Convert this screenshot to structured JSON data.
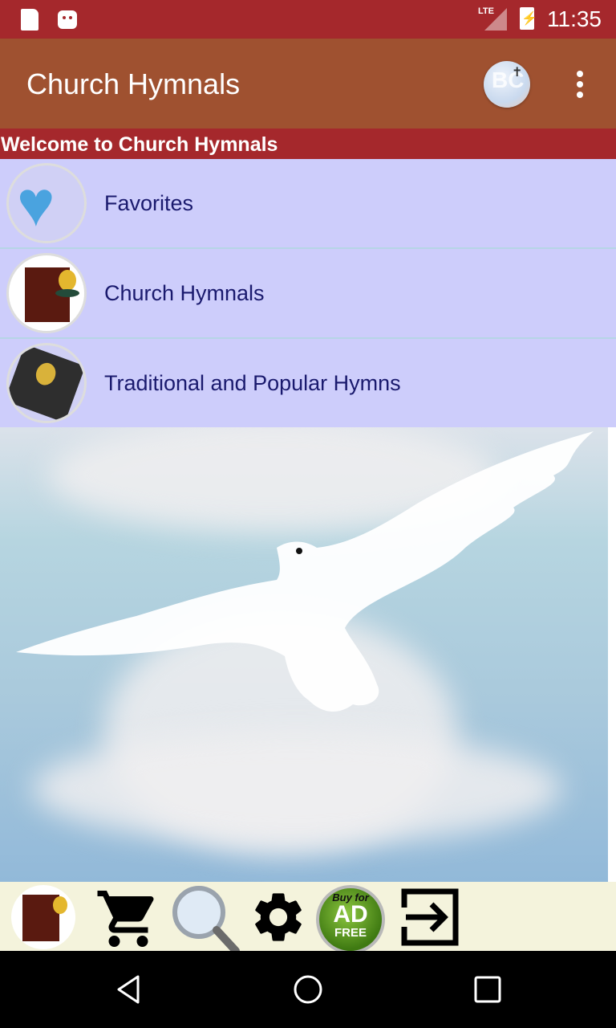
{
  "status_bar": {
    "left_icons": [
      "sd-card-icon",
      "android-debug-icon"
    ],
    "network": "LTE",
    "battery_icon": "battery-charging-icon",
    "time": "11:35"
  },
  "app_bar": {
    "title": "Church Hymnals",
    "logo_text": "BC",
    "logo_icon": "bible-church-logo-icon",
    "overflow_icon": "more-vert-icon"
  },
  "welcome_banner": "Welcome to Church Hymnals",
  "menu": {
    "items": [
      {
        "label": "Favorites",
        "icon": "heart-icon"
      },
      {
        "label": "Church Hymnals",
        "icon": "hymnal-book-icon"
      },
      {
        "label": "Traditional and Popular Hymns",
        "icon": "black-hymn-book-icon"
      }
    ]
  },
  "hero": {
    "image": "dove-over-cloud-image"
  },
  "bottom_toolbar": {
    "buttons": [
      {
        "name": "hymnal-button",
        "icon": "hymnal-book-icon"
      },
      {
        "name": "cart-button",
        "icon": "cart-icon"
      },
      {
        "name": "search-button",
        "icon": "magnifier-icon"
      },
      {
        "name": "settings-button",
        "icon": "gear-icon"
      },
      {
        "name": "ad-free-button",
        "icon": "ad-free-badge-icon",
        "text_top": "Buy for",
        "text_mid": "AD",
        "text_bottom": "FREE"
      },
      {
        "name": "exit-button",
        "icon": "exit-icon"
      }
    ]
  },
  "nav_bar": {
    "buttons": [
      "back-icon",
      "home-icon",
      "recents-icon"
    ]
  },
  "colors": {
    "status_bar": "#a5282c",
    "app_bar": "#9f5130",
    "welcome_banner": "#a5282c",
    "list_item_bg": "#cdcdfb",
    "list_text": "#1a1a6e",
    "bottom_bar": "#f4f3dc"
  }
}
